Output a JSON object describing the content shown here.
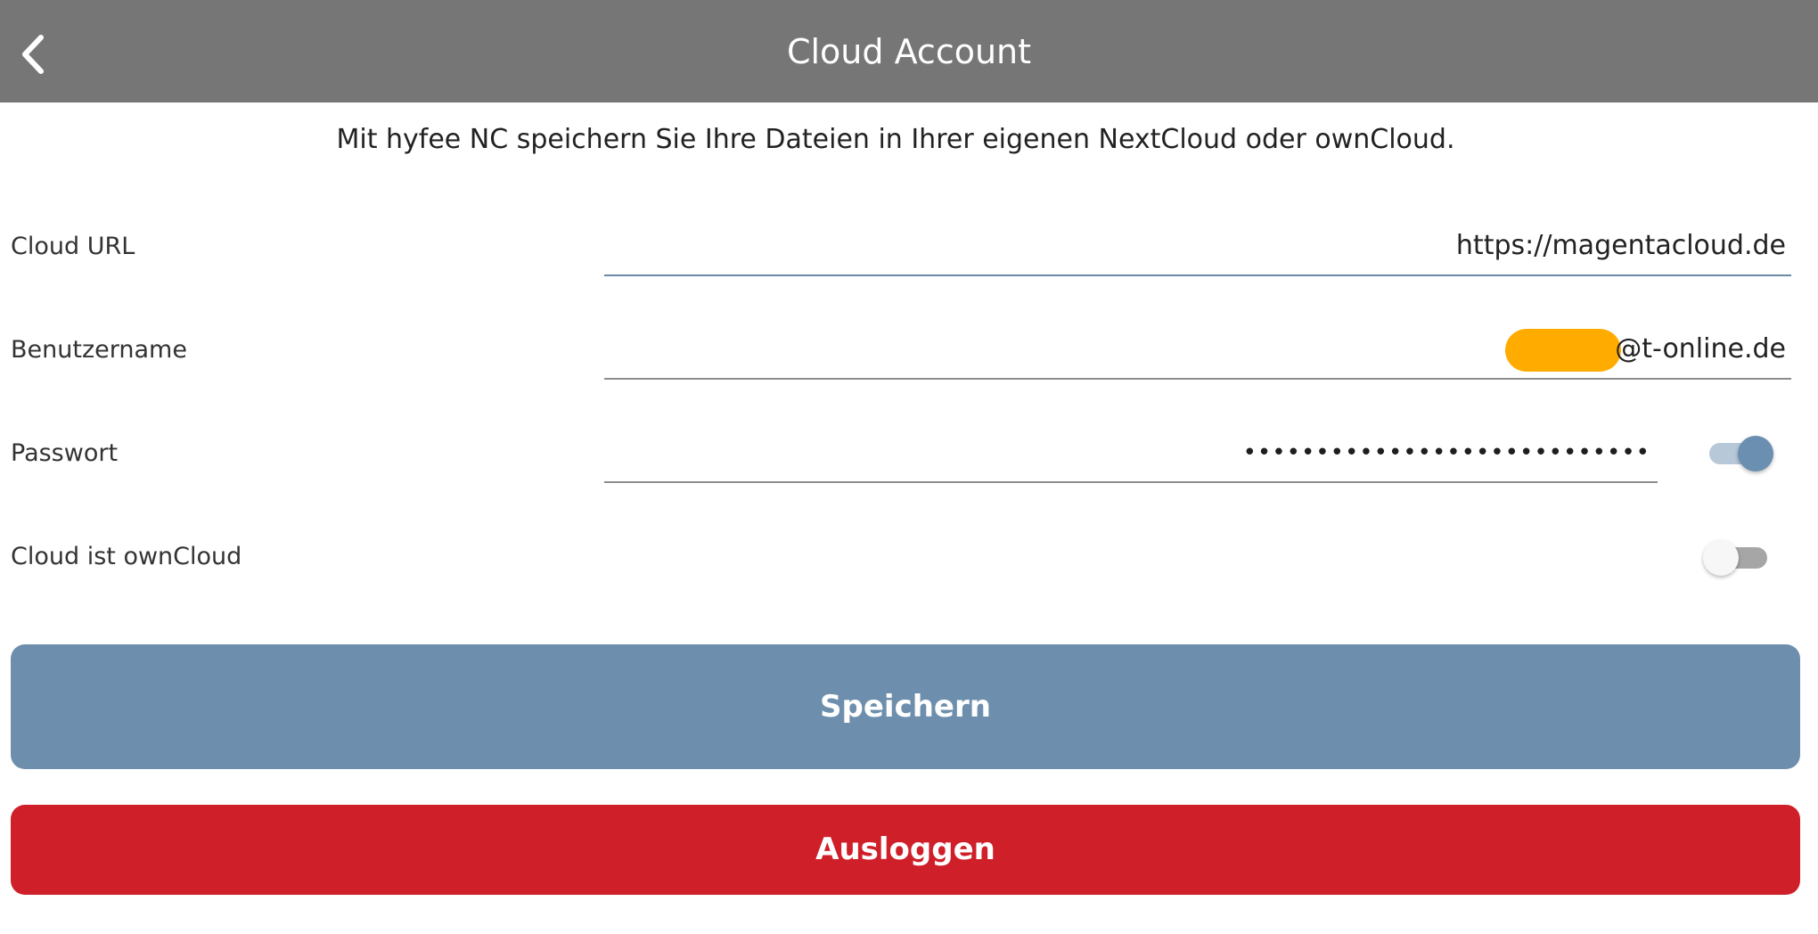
{
  "header": {
    "title": "Cloud Account",
    "back_icon": "chevron-left-icon"
  },
  "intro_text": "Mit hyfee NC speichern Sie Ihre Dateien in Ihrer eigenen NextCloud oder ownCloud.",
  "fields": {
    "cloud_url": {
      "label": "Cloud URL",
      "value": "https://magentacloud.de"
    },
    "username": {
      "label": "Benutzername",
      "value_suffix": "@t-online.de",
      "redaction_color": "#ffab00"
    },
    "password": {
      "label": "Passwort",
      "value": "••••••••••••••••••••••••••••",
      "show_password_toggle": true
    },
    "owncloud": {
      "label": "Cloud ist ownCloud",
      "toggle": false
    }
  },
  "buttons": {
    "save_label": "Speichern",
    "logout_label": "Ausloggen"
  },
  "colors": {
    "header_bg": "#767676",
    "accent": "#6d8fad",
    "danger": "#cf1f29"
  }
}
